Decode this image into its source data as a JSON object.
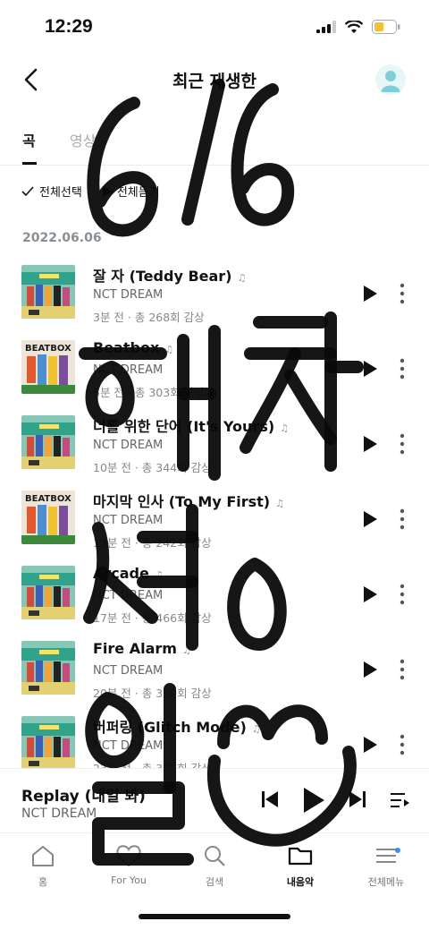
{
  "status": {
    "time": "12:29"
  },
  "header": {
    "title": "최근 재생한"
  },
  "tabs": [
    {
      "label": "곡"
    },
    {
      "label": "영상"
    }
  ],
  "actions": {
    "select_all": "전체선택",
    "play_all": "전체듣기"
  },
  "date": "2022.06.06",
  "songs": [
    {
      "title": "잘 자 (Teddy Bear)",
      "artist": "NCT DREAM",
      "meta": "3분 전 · 총 268회 감상",
      "art": "glitch"
    },
    {
      "title": "Beatbox",
      "artist": "NCT DREAM",
      "meta": "5분 전 · 총 303회 감상",
      "art": "beatbox"
    },
    {
      "title": "너를 위한 단어 (It's Yours)",
      "artist": "NCT DREAM",
      "meta": "10분 전 · 총 344회 감상",
      "art": "glitch"
    },
    {
      "title": "마지막 인사 (To My First)",
      "artist": "NCT DREAM",
      "meta": "13분 전 · 총 242회 감상",
      "art": "beatbox"
    },
    {
      "title": "Arcade",
      "artist": "NCT DREAM",
      "meta": "17분 전 · 총 466회 감상",
      "art": "glitch"
    },
    {
      "title": "Fire Alarm",
      "artist": "NCT DREAM",
      "meta": "20분 전 · 총 330회 감상",
      "art": "glitch"
    },
    {
      "title": "버퍼링 (Glitch Mode)",
      "artist": "NCT DREAM",
      "meta": "23분 전 · 총 325회 감상",
      "art": "glitch"
    }
  ],
  "mini_player": {
    "title": "Replay (내일 봐)",
    "artist": "NCT DREAM"
  },
  "tabbar": [
    {
      "label": "홈",
      "icon": "home-icon"
    },
    {
      "label": "For You",
      "icon": "heart-icon"
    },
    {
      "label": "검색",
      "icon": "search-icon"
    },
    {
      "label": "내음악",
      "icon": "folder-icon"
    },
    {
      "label": "전체메뉴",
      "icon": "menu-icon"
    }
  ],
  "handwriting": "6/6 해찬 생일",
  "colors": {
    "accent": "#3a8bff",
    "text": "#111111",
    "muted": "#8a8f94"
  }
}
